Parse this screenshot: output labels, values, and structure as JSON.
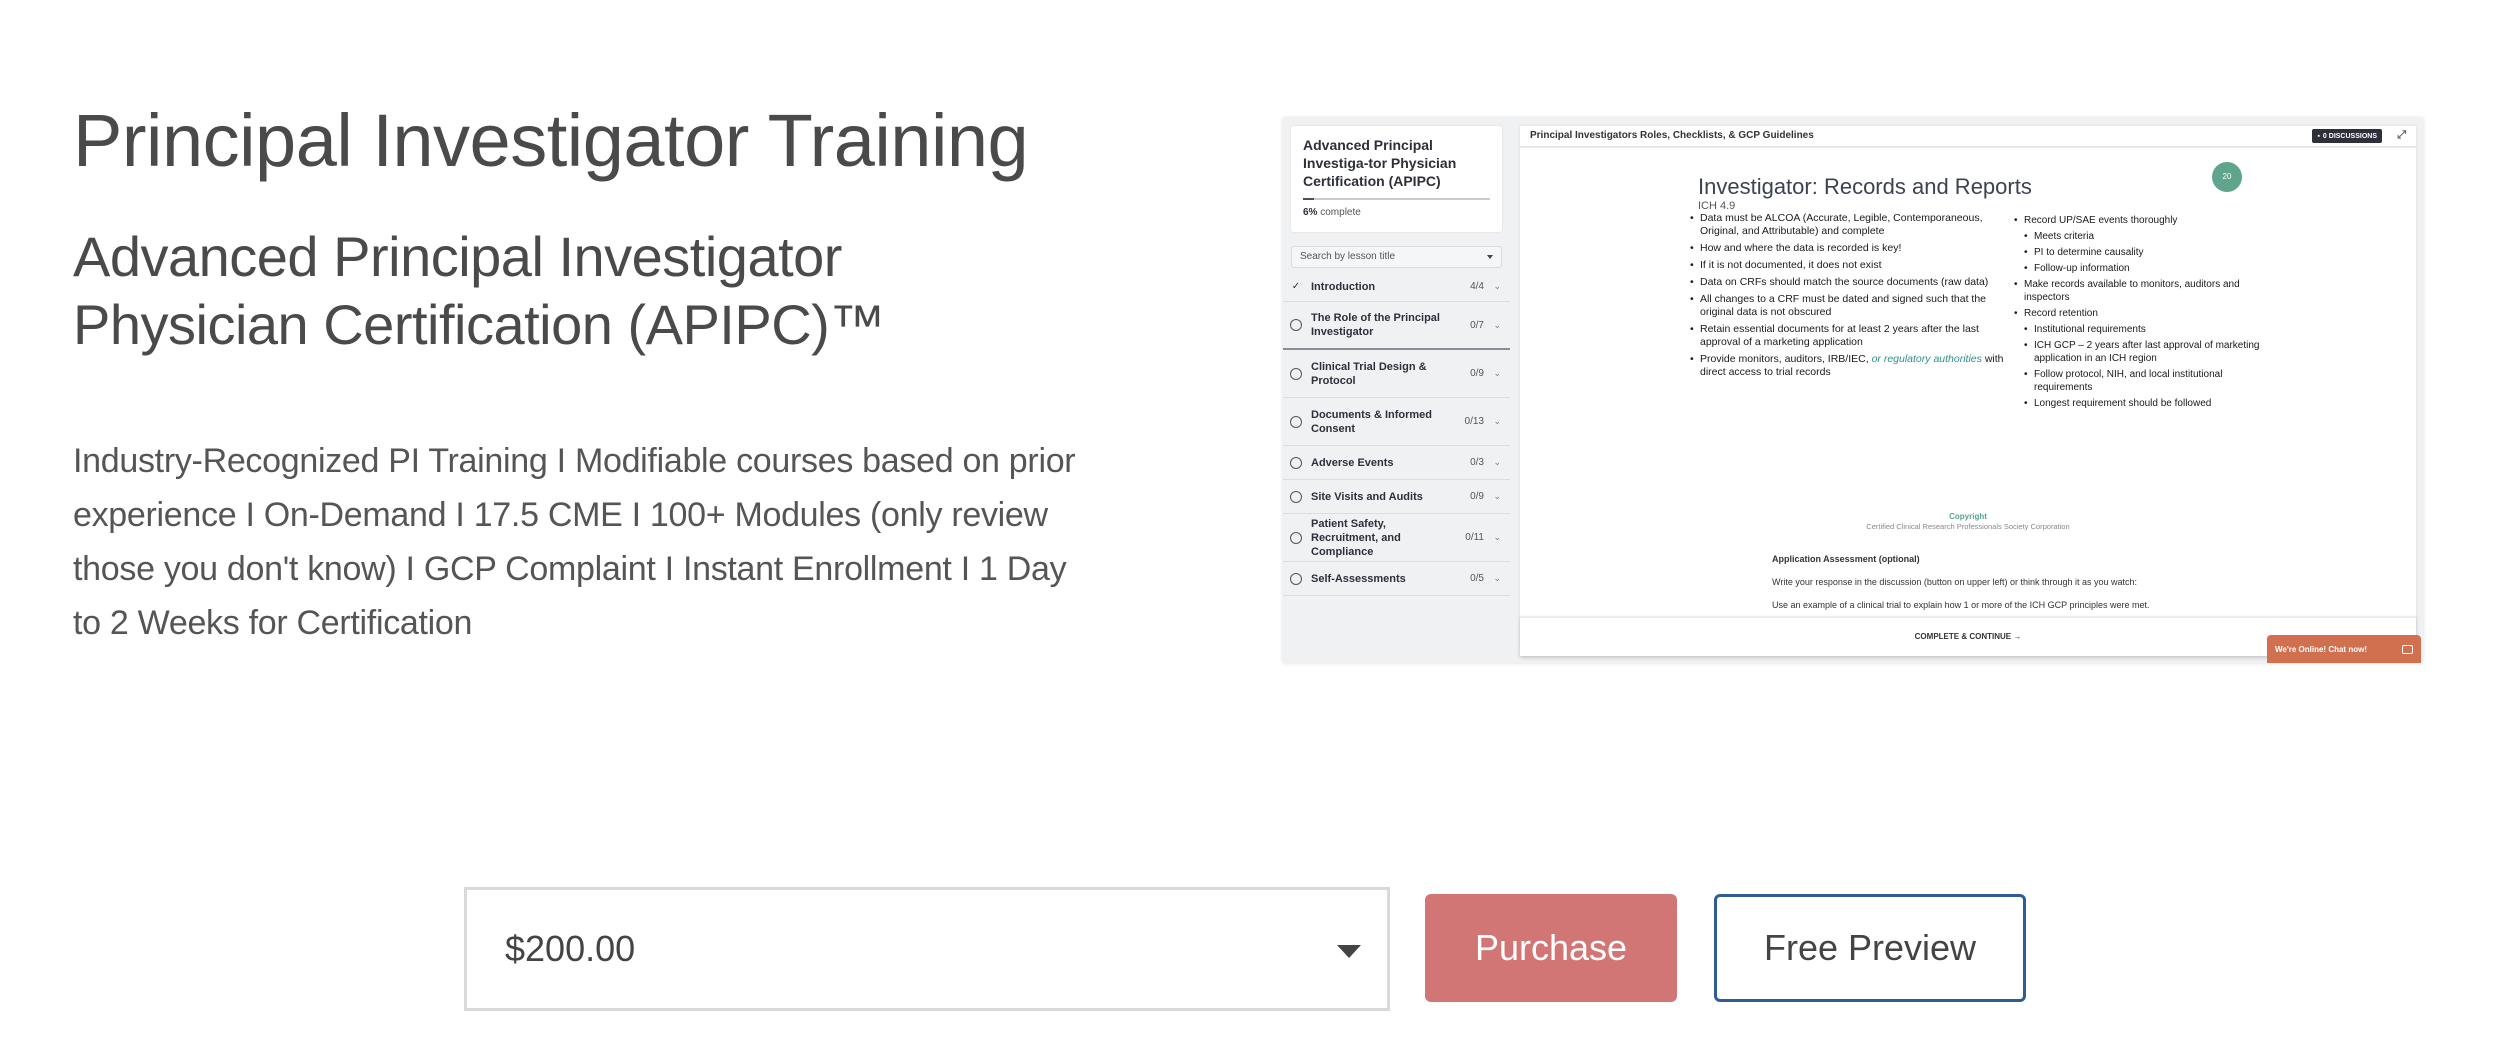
{
  "header": {
    "title": "Principal Investigator Training",
    "subtitle": "Advanced Principal Investigator Physician Certification (APIPC)™",
    "description": "Industry-Recognized PI Training I Modifiable courses based on prior experience I On-Demand I 17.5 CME I 100+ Modules (only review those you don't know) I GCP Complaint I Instant Enrollment I 1 Day to 2 Weeks for Certification"
  },
  "preview": {
    "course": {
      "title": "Advanced Principal Investiga-tor Physician Certification (APIPC)",
      "progress_percent": 6,
      "progress_value": "6%",
      "progress_suffix": "complete"
    },
    "search": {
      "placeholder": "Search by lesson title"
    },
    "chapters": [
      {
        "title": "Introduction",
        "count": "4/4",
        "status": "done"
      },
      {
        "title": "The Role of the Principal Investigator",
        "count": "0/7",
        "status": "open"
      },
      {
        "title": "Clinical Trial Design & Protocol",
        "count": "0/9",
        "status": "open"
      },
      {
        "title": "Documents & Informed Consent",
        "count": "0/13",
        "status": "open"
      },
      {
        "title": "Adverse Events",
        "count": "0/3",
        "status": "open"
      },
      {
        "title": "Site Visits and Audits",
        "count": "0/9",
        "status": "open"
      },
      {
        "title": "Patient Safety, Recruitment, and Compliance",
        "count": "0/11",
        "status": "open"
      },
      {
        "title": "Self-Assessments",
        "count": "0/5",
        "status": "open"
      }
    ],
    "lesson_title": "Principal Investigators Roles, Checklists, & GCP Guidelines",
    "discussions_label": "0 DISCUSSIONS",
    "slide": {
      "badge": "20",
      "title": "Investigator: Records and Reports",
      "subtitle": "ICH 4.9",
      "left_bullets": [
        "Data must be ALCOA (Accurate, Legible, Contemporaneous, Original, and Attributable) and complete",
        "How and where the data is recorded is key!",
        "If it is not documented, it does not exist",
        "Data on CRFs should match the source documents (raw data)",
        "All changes to a CRF must be dated and signed such that the original data is not obscured",
        "Retain essential documents for at least 2 years after the last approval of a marketing application"
      ],
      "left_last_prefix": "Provide monitors, auditors, IRB/IEC,",
      "left_last_teal": "or regulatory authorities",
      "left_last_suffix": "with direct access to trial records",
      "right_bullets": [
        {
          "text": "Record UP/SAE events thoroughly",
          "level": 1
        },
        {
          "text": "Meets criteria",
          "level": 2
        },
        {
          "text": "PI to determine causality",
          "level": 2
        },
        {
          "text": "Follow-up information",
          "level": 2
        },
        {
          "text": "Make records available to monitors, auditors and inspectors",
          "level": 1
        },
        {
          "text": "Record retention",
          "level": 1
        },
        {
          "text": "Institutional requirements",
          "level": 2
        },
        {
          "text": "ICH GCP – 2 years after last approval of marketing application in an ICH region",
          "level": 2
        },
        {
          "text": "Follow protocol, NIH, and local institutional requirements",
          "level": 2
        },
        {
          "text": "Longest requirement should be followed",
          "level": 2
        }
      ],
      "copyright": "Copyright",
      "copyright_org": "Certified Clinical Research Professionals Society Corporation"
    },
    "assessment": {
      "heading": "Application Assessment (optional)",
      "line1": "Write your response in the discussion (button on upper left) or think through it as you watch:",
      "line2": "Use an example of a clinical trial to explain how 1 or more of the ICH GCP principles were met."
    },
    "complete_label": "COMPLETE & CONTINUE →",
    "chat_label": "We're Online! Chat now!"
  },
  "purchase": {
    "price_selected": "$200.00",
    "purchase_label": "Purchase",
    "preview_label": "Free Preview"
  },
  "colors": {
    "purchase": "#d17575",
    "preview_border": "#2f5d93",
    "chat": "#d0704f",
    "badge": "#5fa58b"
  }
}
